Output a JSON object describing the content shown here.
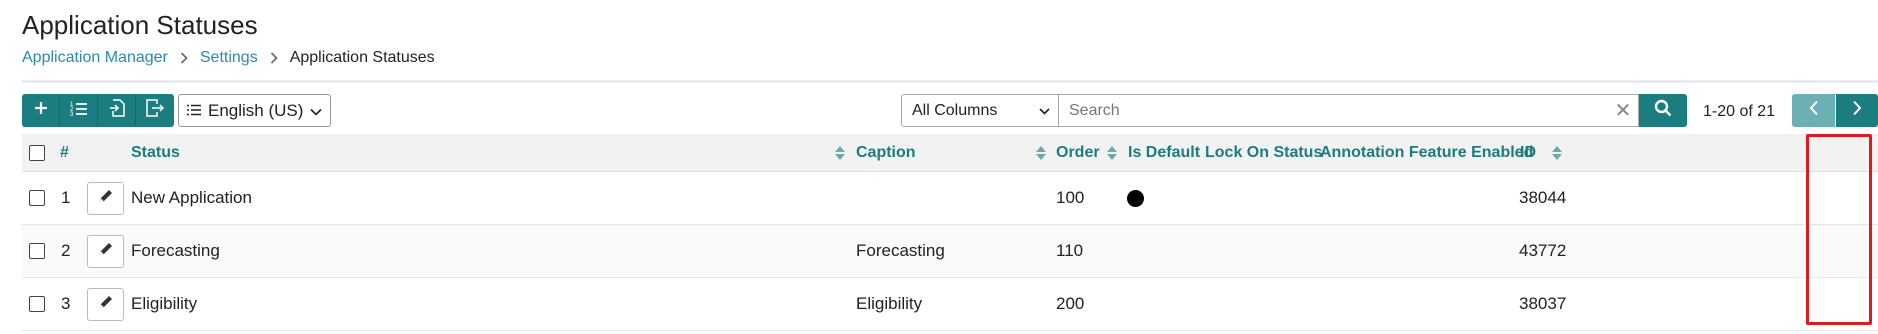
{
  "page": {
    "title": "Application Statuses",
    "breadcrumb": [
      {
        "label": "Application Manager",
        "link": true
      },
      {
        "label": "Settings",
        "link": true
      },
      {
        "label": "Application Statuses",
        "link": false
      }
    ]
  },
  "toolbar": {
    "buttons": [
      "add-icon",
      "ordered-list-icon",
      "import-icon",
      "export-icon"
    ],
    "language": "English (US)"
  },
  "search": {
    "column_filter": "All Columns",
    "placeholder": "Search",
    "value": ""
  },
  "pager": {
    "range_text": "1-20 of 21"
  },
  "grid": {
    "columns": {
      "num": "#",
      "status": "Status",
      "caption": "Caption",
      "order": "Order",
      "is_default": "Is Default",
      "lock_on_status": "Lock On Status",
      "annotation": "Annotation Feature Enabled",
      "id": "ID"
    },
    "rows": [
      {
        "num": "1",
        "status": "New Application",
        "caption": "",
        "order": "100",
        "is_default": true,
        "id": "38044"
      },
      {
        "num": "2",
        "status": "Forecasting",
        "caption": "Forecasting",
        "order": "110",
        "is_default": false,
        "id": "43772"
      },
      {
        "num": "3",
        "status": "Eligibility",
        "caption": "Eligibility",
        "order": "200",
        "is_default": false,
        "id": "38037"
      }
    ]
  },
  "colors": {
    "accent": "#1c7d80",
    "link": "#2a8bb3",
    "highlight": "#e0191f"
  }
}
